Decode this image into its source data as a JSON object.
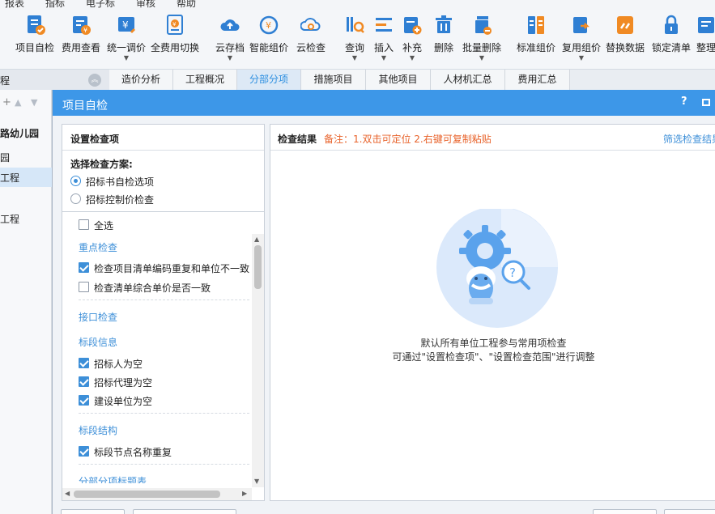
{
  "menu": [
    "报表",
    "指标",
    "电子标",
    "审核",
    "帮助"
  ],
  "toolbar": [
    {
      "label": "项目自检",
      "icon": "project-check-icon",
      "dropdown": false
    },
    {
      "label": "费用查看",
      "icon": "cost-view-icon",
      "dropdown": false
    },
    {
      "label": "统一调价",
      "icon": "unified-price-icon",
      "dropdown": true
    },
    {
      "label": "全费用切换",
      "icon": "full-cost-switch-icon",
      "dropdown": false
    },
    {
      "label": "云存档",
      "icon": "cloud-archive-icon",
      "dropdown": true
    },
    {
      "label": "智能组价",
      "icon": "smart-pricing-icon",
      "dropdown": false
    },
    {
      "label": "云检查",
      "icon": "cloud-check-icon",
      "dropdown": false
    },
    {
      "label": "查询",
      "icon": "query-icon",
      "dropdown": true
    },
    {
      "label": "插入",
      "icon": "insert-icon",
      "dropdown": true
    },
    {
      "label": "补充",
      "icon": "supplement-icon",
      "dropdown": true
    },
    {
      "label": "删除",
      "icon": "delete-icon",
      "dropdown": false
    },
    {
      "label": "批量删除",
      "icon": "batch-delete-icon",
      "dropdown": true
    },
    {
      "label": "标准组价",
      "icon": "standard-pricing-icon",
      "dropdown": false
    },
    {
      "label": "复用组价",
      "icon": "reuse-pricing-icon",
      "dropdown": true
    },
    {
      "label": "替换数据",
      "icon": "replace-data-icon",
      "dropdown": false
    },
    {
      "label": "锁定清单",
      "icon": "lock-list-icon",
      "dropdown": false
    },
    {
      "label": "整理",
      "icon": "organize-icon",
      "dropdown": false
    }
  ],
  "left_head": "程",
  "left_tree": [
    "路幼儿园",
    "园",
    "工程",
    "工程"
  ],
  "tabs": [
    {
      "label": "造价分析",
      "active": false
    },
    {
      "label": "工程概况",
      "active": false
    },
    {
      "label": "分部分项",
      "active": true
    },
    {
      "label": "措施项目",
      "active": false
    },
    {
      "label": "其他项目",
      "active": false
    },
    {
      "label": "人材机汇总",
      "active": false
    },
    {
      "label": "费用汇总",
      "active": false
    }
  ],
  "dialog": {
    "title": "项目自检",
    "help": "?",
    "left": {
      "header": "设置检查项",
      "scheme_title": "选择检查方案:",
      "schemes": [
        {
          "label": "招标书自检选项",
          "selected": true
        },
        {
          "label": "招标控制价检查",
          "selected": false
        }
      ],
      "select_all": {
        "label": "全选",
        "checked": false
      },
      "groups": [
        {
          "title": "重点检查",
          "items": [
            {
              "label": "检查项目清单编码重复和单位不一致",
              "checked": true
            },
            {
              "label": "检查清单综合单价是否一致",
              "checked": false
            }
          ]
        },
        {
          "title": "接口检查",
          "items": []
        },
        {
          "title": "标段信息",
          "items": [
            {
              "label": "招标人为空",
              "checked": true
            },
            {
              "label": "招标代理为空",
              "checked": true
            },
            {
              "label": "建设单位为空",
              "checked": true
            }
          ]
        },
        {
          "title": "标段结构",
          "items": [
            {
              "label": "标段节点名称重复",
              "checked": true
            }
          ]
        },
        {
          "title": "分部分项标题表",
          "items": []
        }
      ]
    },
    "right": {
      "header": "检查结果",
      "note": "备注：1.双击可定位 2.右键可复制粘贴",
      "filter": "筛选检查结果",
      "empty_line1": "默认所有单位工程参与常用项检查",
      "empty_line2": "可通过\"设置检查项\"、\"设置检查范围\"进行调整"
    }
  }
}
